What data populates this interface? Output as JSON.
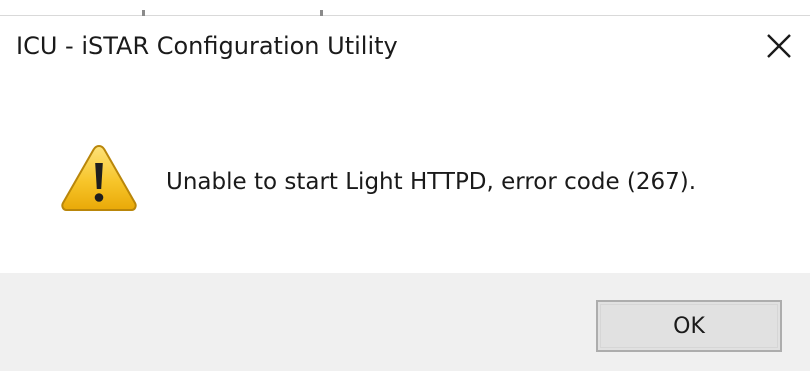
{
  "window": {
    "title": "ICU - iSTAR Configuration Utility",
    "close_icon": "close-icon"
  },
  "content": {
    "icon": "warning-icon",
    "message": "Unable to start Light HTTPD, error code (267)."
  },
  "footer": {
    "ok_label": "OK"
  },
  "colors": {
    "footer_bg": "#f0f0f0",
    "button_bg": "#e1e1e1",
    "button_border": "#adadad",
    "warning_yellow": "#f5c518"
  }
}
